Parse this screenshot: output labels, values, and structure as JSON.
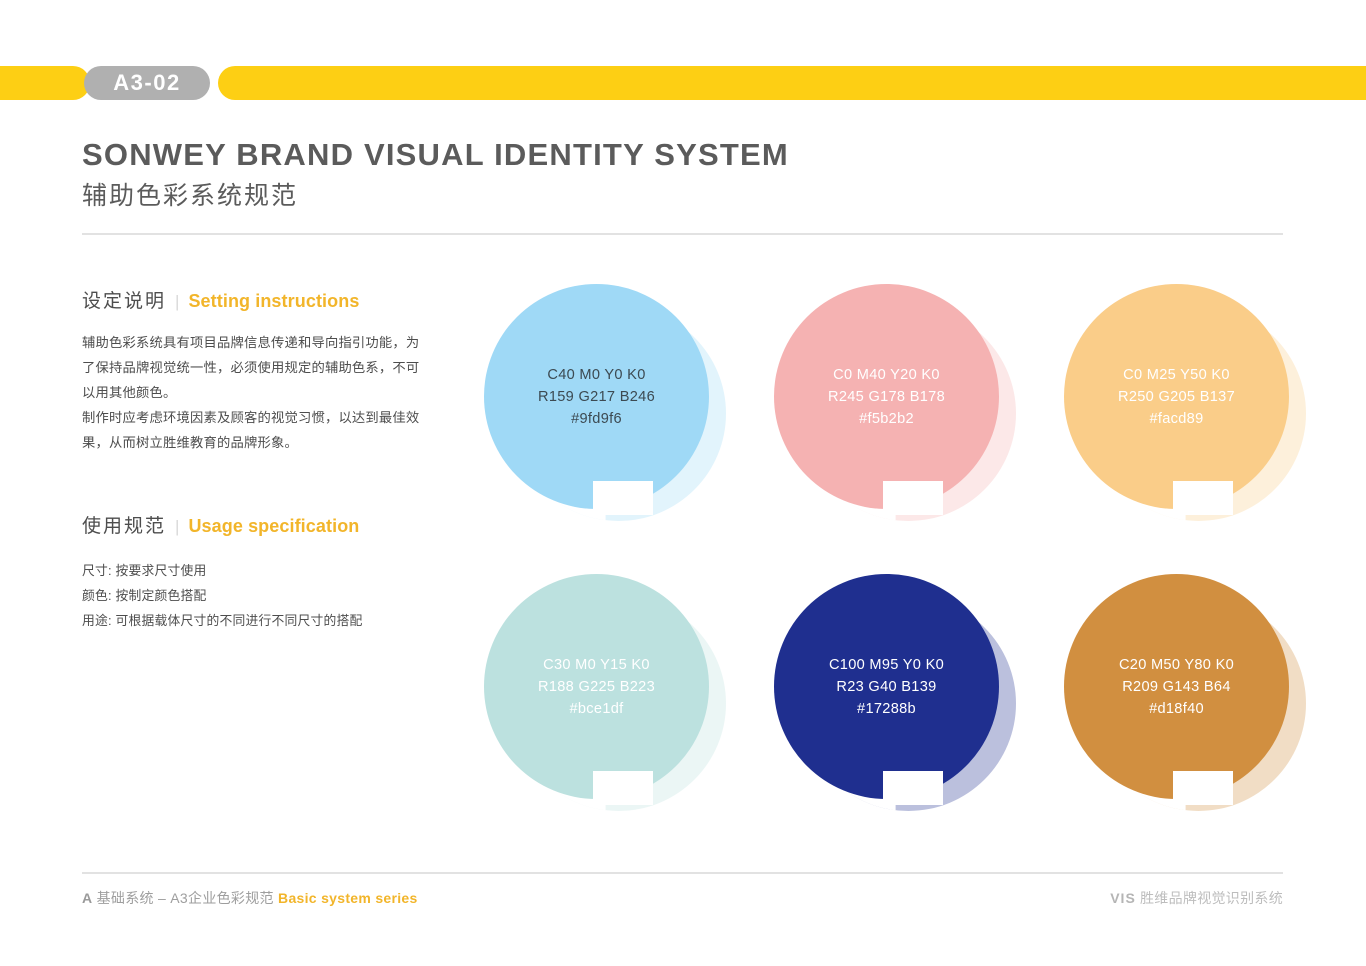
{
  "topbar": {
    "badge_label": "A3-02",
    "bar_color": "#fdcf14",
    "badge_color": "#b0b0b0"
  },
  "title": {
    "english": "SONWEY BRAND VISUAL IDENTITY SYSTEM",
    "chinese": "辅助色彩系统规范"
  },
  "sections": {
    "setting": {
      "cn": "设定说明",
      "divider": "|",
      "en": "Setting instructions",
      "paragraphs": [
        "辅助色彩系统具有项目品牌信息传递和导向指引功能，为了保持品牌视觉统一性，必须使用规定的辅助色系，不可以用其他颜色。",
        "制作时应考虑环境因素及顾客的视觉习惯，以达到最佳效果，从而树立胜维教育的品牌形象。"
      ]
    },
    "usage": {
      "cn": "使用规范",
      "divider": "|",
      "en": "Usage specification",
      "items": [
        "尺寸: 按要求尺寸使用",
        "颜色: 按制定颜色搭配",
        "用途: 可根据载体尺寸的不同进行不同尺寸的搭配"
      ]
    }
  },
  "swatches": [
    {
      "name": "light-blue",
      "cmyk": "C40  M0  Y0  K0",
      "rgb": "R159  G217  B246",
      "hex": "#9fd9f6",
      "fill": "#9fd9f6",
      "text_color": "#3c4a52"
    },
    {
      "name": "rose-pink",
      "cmyk": "C0  M40  Y20  K0",
      "rgb": "R245  G178  B178",
      "hex": "#f5b2b2",
      "fill": "#f5b2b2",
      "text_color": "#ffffff"
    },
    {
      "name": "warm-sand",
      "cmyk": "C0  M25  Y50  K0",
      "rgb": "R250  G205  B137",
      "hex": "#facd89",
      "fill": "#facd89",
      "text_color": "#ffffff"
    },
    {
      "name": "pale-mint",
      "cmyk": "C30  M0  Y15  K0",
      "rgb": "R188  G225  B223",
      "hex": "#bce1df",
      "fill": "#bce1df",
      "text_color": "#ffffff"
    },
    {
      "name": "deep-navy",
      "cmyk": "C100  M95  Y0  K0",
      "rgb": "R23  G40  B139",
      "hex": "#17288b",
      "fill": "#1f2f8f",
      "text_color": "#ffffff"
    },
    {
      "name": "ochre-bronze",
      "cmyk": "C20  M50  Y80  K0",
      "rgb": "R209  G143  B64",
      "hex": "#d18f40",
      "fill": "#d18f40",
      "text_color": "#ffffff"
    }
  ],
  "footer": {
    "left_a": "A",
    "left_cn": "基础系统 – A3企业色彩规范",
    "left_en": "Basic system series",
    "right_vis": "VIS",
    "right_cn": "胜维品牌视觉识别系统"
  }
}
